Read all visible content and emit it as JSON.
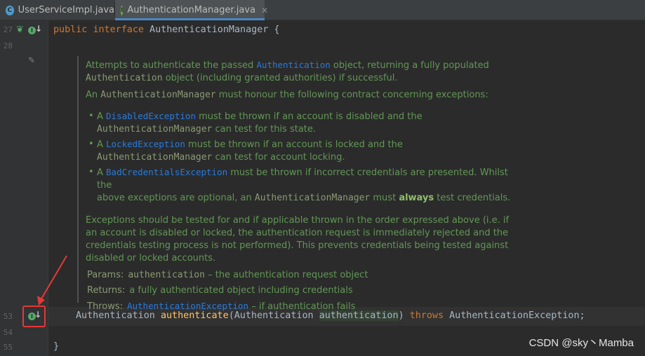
{
  "tabs": [
    {
      "label": "UserServiceImpl.java",
      "icon": "class-icon",
      "icon_letter": "C",
      "active": false
    },
    {
      "label": "AuthenticationManager.java",
      "icon": "interface-icon",
      "icon_letter": "I",
      "active": true
    }
  ],
  "line_numbers": {
    "l27": "27",
    "l28": "28",
    "l53": "53",
    "l54": "54",
    "l55": "55"
  },
  "code": {
    "line27": {
      "kw1": "public",
      "kw2": "interface",
      "name": " AuthenticationManager {"
    },
    "line53": {
      "type": "Authentication ",
      "method": "authenticate",
      "open": "(Authentication ",
      "param": "authentication",
      "close": ") ",
      "throws": "throws",
      "exc": " AuthenticationException;"
    },
    "line55": "}"
  },
  "doc": {
    "p1_a": "Attempts to authenticate the passed ",
    "p1_link": "Authentication",
    "p1_b": " object, returning a fully populated",
    "p1_mono": "Authentication",
    "p1_c": " object (including granted authorities) if successful.",
    "p2_a": "An ",
    "p2_mono": "AuthenticationManager",
    "p2_b": " must honour the following contract concerning exceptions:",
    "b1_a": "A ",
    "b1_link": "DisabledException",
    "b1_b": " must be thrown if an account is disabled and the",
    "b1_mono": "AuthenticationManager",
    "b1_c": " can test for this state.",
    "b2_a": "A ",
    "b2_link": "LockedException",
    "b2_b": " must be thrown if an account is locked and the",
    "b2_mono": "AuthenticationManager",
    "b2_c": " can test for account locking.",
    "b3_a": "A ",
    "b3_link": "BadCredentialsException",
    "b3_b": " must be thrown if incorrect credentials are presented. Whilst the",
    "b3_c": "above exceptions are optional, an ",
    "b3_mono": "AuthenticationManager",
    "b3_d": " must ",
    "b3_bold": "always",
    "b3_e": " test credentials.",
    "p3": "Exceptions should be tested for and if applicable thrown in the order expressed above (i.e. if an account is disabled or locked, the authentication request is immediately rejected and the credentials testing process is not performed). This prevents credentials being tested against disabled or locked accounts.",
    "params_tag": "Params:",
    "params_mono": "authentication",
    "params_text": " – the authentication request object",
    "returns_tag": "Returns:",
    "returns_text": "a fully authenticated object including credentials",
    "throws_tag": "Throws:",
    "throws_link": "AuthenticationException",
    "throws_text": " – if authentication fails"
  },
  "watermark": "CSDN @sky丶Mamba",
  "colors": {
    "keyword": "#cc7832",
    "method": "#ffc66d",
    "doc_text": "#629755",
    "doc_link": "#287bde",
    "annotation": "#e53935"
  }
}
